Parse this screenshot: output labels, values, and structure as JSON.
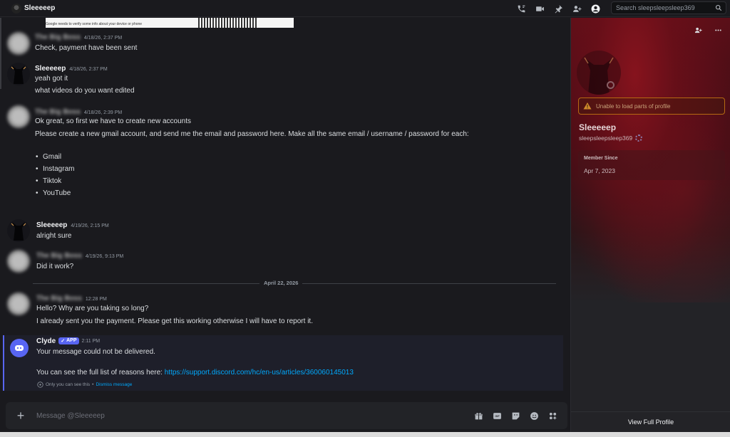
{
  "header": {
    "channel_name": "Sleeeeep",
    "search_placeholder": "Search sleepsleepsleep369",
    "icons": [
      "phone-call-icon",
      "video-call-icon",
      "pin-icon",
      "add-friends-icon",
      "user-profile-icon",
      "search-icon"
    ]
  },
  "qr_notice": "Google needs to verify some info about your device or phone",
  "messages": [
    {
      "author": "The Big Boss",
      "time": "4/18/26, 2:37 PM",
      "lines": [
        "Check, payment have been sent"
      ]
    },
    {
      "author": "Sleeeeep",
      "time": "4/18/26, 2:37 PM",
      "lines": [
        "yeah got it",
        "what videos do you want edited"
      ]
    },
    {
      "author": "The Big Boss",
      "time": "4/18/26, 2:39 PM",
      "lines": [
        "Ok great, so first we have to create new accounts",
        "Please create a new gmail account, and send me the email and password here. Make all the same email / username / password for each:"
      ],
      "bullets": [
        "Gmail",
        "Instagram",
        "Tiktok",
        "YouTube"
      ]
    },
    {
      "author": "Sleeeeep",
      "time": "4/19/26, 2:15 PM",
      "lines": [
        "alright sure"
      ]
    },
    {
      "author": "The Big Boss",
      "time": "4/19/26, 9:13 PM",
      "lines": [
        "Did it work?"
      ]
    },
    {
      "author": "The Big Boss",
      "time": "12:28 PM",
      "lines": [
        "Hello? Why are you taking so long?",
        "I already sent you the payment. Please get this working otherwise I will have to report it."
      ]
    }
  ],
  "date_divider": "April 22, 2026",
  "clyde": {
    "author": "Clyde",
    "badge": "APP",
    "time": "2:11 PM",
    "line1": "Your message could not be delivered.",
    "line2_prefix": "You can see the full list of reasons here: ",
    "link": "https://support.discord.com/hc/en-us/articles/360060145013",
    "ephemeral_text": "Only you can see this",
    "separator": "•",
    "dismiss": "Dismiss message"
  },
  "composer": {
    "placeholder": "Message @Sleeeeep",
    "icons": [
      "gift-icon",
      "gif-icon",
      "sticker-icon",
      "emoji-icon",
      "apps-icon"
    ],
    "gif_label": "GIF"
  },
  "profile": {
    "warning": "Unable to load parts of profile",
    "display_name": "Sleeeeep",
    "username": "sleepsleepsleep369",
    "member_since_label": "Member Since",
    "member_since_value": "Apr 7, 2023",
    "view_full_profile": "View Full Profile",
    "accent_color": "#5a0f18"
  },
  "colors": {
    "background": "#1a1a1e",
    "link": "#00a8fc",
    "brand": "#5865f2",
    "warning_border": "#b56a12"
  }
}
